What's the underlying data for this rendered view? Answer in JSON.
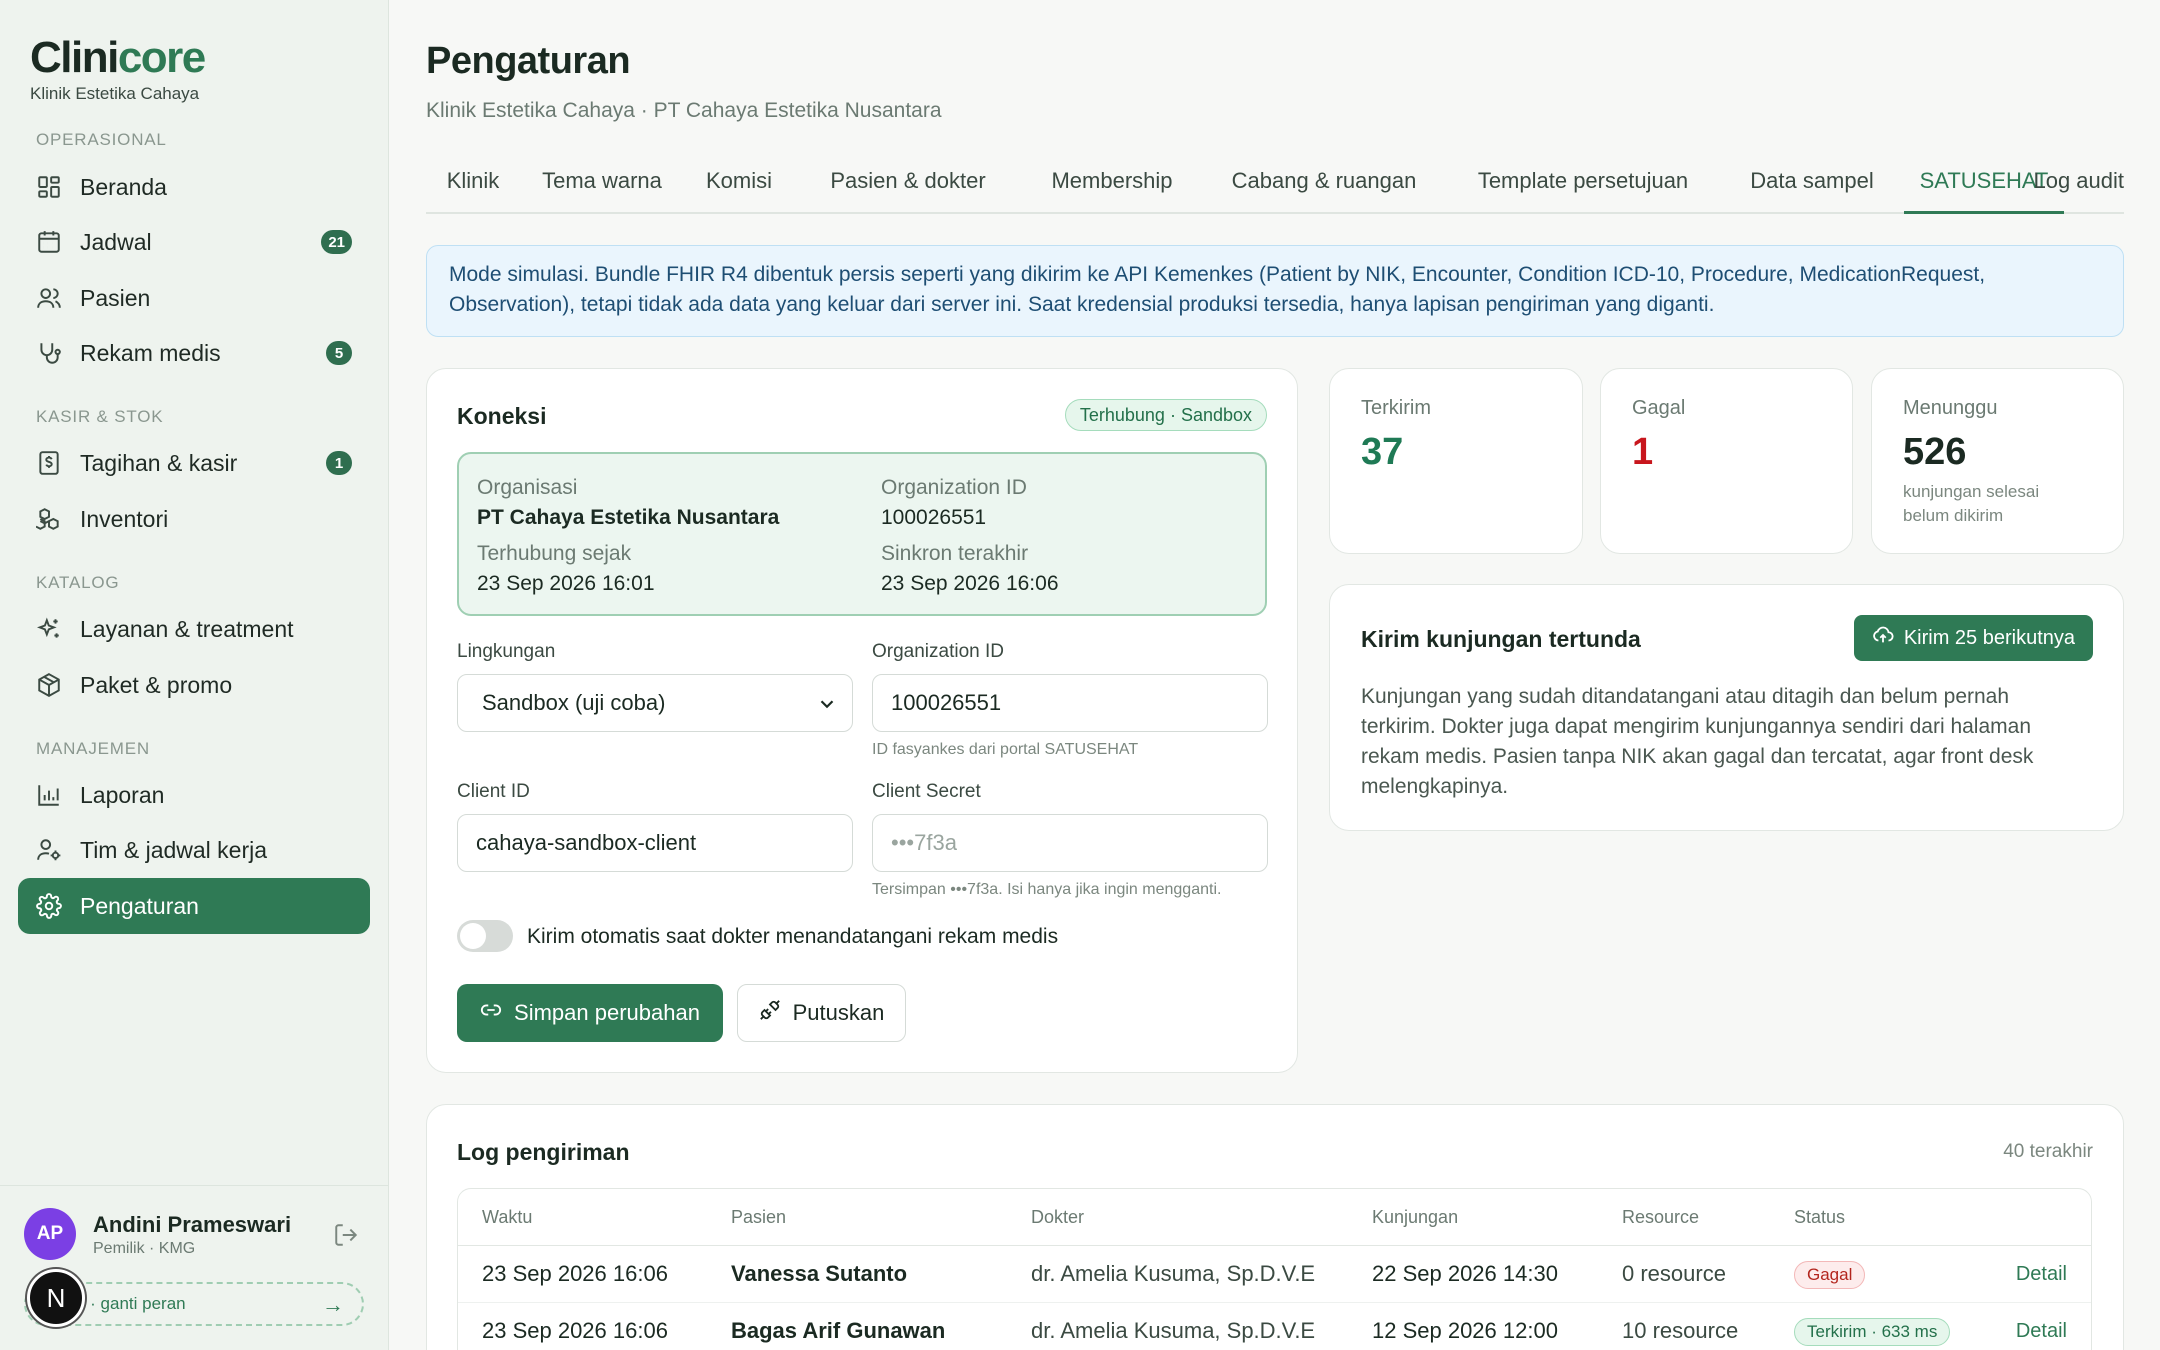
{
  "brand": {
    "name_part1": "Clini",
    "name_part2": "core",
    "clinic": "Klinik Estetika Cahaya"
  },
  "sidebar": {
    "sections": [
      "OPERASIONAL",
      "KASIR & STOK",
      "KATALOG",
      "MANAJEMEN"
    ],
    "items": [
      {
        "label": "Beranda",
        "icon": "grid-icon",
        "badge": ""
      },
      {
        "label": "Jadwal",
        "icon": "calendar-icon",
        "badge": "21"
      },
      {
        "label": "Pasien",
        "icon": "users-icon",
        "badge": ""
      },
      {
        "label": "Rekam medis",
        "icon": "stethoscope-icon",
        "badge": "5"
      },
      {
        "label": "Tagihan & kasir",
        "icon": "receipt-icon",
        "badge": "1"
      },
      {
        "label": "Inventori",
        "icon": "boxes-icon",
        "badge": ""
      },
      {
        "label": "Layanan & treatment",
        "icon": "sparkles-icon",
        "badge": ""
      },
      {
        "label": "Paket & promo",
        "icon": "package-icon",
        "badge": ""
      },
      {
        "label": "Laporan",
        "icon": "bar-chart-icon",
        "badge": ""
      },
      {
        "label": "Tim & jadwal kerja",
        "icon": "user-cog-icon",
        "badge": ""
      },
      {
        "label": "Pengaturan",
        "icon": "gear-icon",
        "badge": ""
      }
    ],
    "active_item": "Pengaturan"
  },
  "user": {
    "initials": "AP",
    "name": "Andini Prameswari",
    "role": "Pemilik · KMG",
    "switch_label": "o · ganti peran",
    "dev_bubble": "N"
  },
  "header": {
    "title": "Pengaturan",
    "subtitle": "Klinik Estetika Cahaya · PT Cahaya Estetika Nusantara"
  },
  "tabs": [
    "Klinik",
    "Tema warna",
    "Komisi",
    "Pasien & dokter",
    "Membership",
    "Cabang & ruangan",
    "Template persetujuan",
    "Data sampel",
    "SATUSEHAT",
    "Log audit"
  ],
  "active_tab": "SATUSEHAT",
  "notice": "Mode simulasi. Bundle FHIR R4 dibentuk persis seperti yang dikirim ke API Kemenkes (Patient by NIK, Encounter, Condition ICD-10, Procedure, MedicationRequest, Observation), tetapi tidak ada data yang keluar dari server ini. Saat kredensial produksi tersedia, hanya lapisan pengiriman yang diganti.",
  "connection": {
    "title": "Koneksi",
    "status": "Terhubung · Sandbox",
    "org_label": "Organisasi",
    "org_value": "PT Cahaya Estetika Nusantara",
    "org_id_label": "Organization ID",
    "org_id_value": "100026551",
    "since_label": "Terhubung sejak",
    "since_value": "23 Sep 2026 16:01",
    "sync_label": "Sinkron terakhir",
    "sync_value": "23 Sep 2026 16:06",
    "env_label": "Lingkungan",
    "env_value": "Sandbox (uji coba)",
    "orgid_field_label": "Organization ID",
    "orgid_field_value": "100026551",
    "orgid_hint": "ID fasyankes dari portal SATUSEHAT",
    "client_id_label": "Client ID",
    "client_id_value": "cahaya-sandbox-client",
    "client_secret_label": "Client Secret",
    "client_secret_placeholder": "•••7f3a",
    "client_secret_hint": "Tersimpan •••7f3a. Isi hanya jika ingin mengganti.",
    "auto_send_label": "Kirim otomatis saat dokter menandatangani rekam medis",
    "auto_send_on": false,
    "save_label": "Simpan perubahan",
    "disconnect_label": "Putuskan"
  },
  "stats": [
    {
      "label": "Terkirim",
      "value": "37",
      "color": "#1f7a55",
      "note": ""
    },
    {
      "label": "Gagal",
      "value": "1",
      "color": "#c8161d",
      "note": ""
    },
    {
      "label": "Menunggu",
      "value": "526",
      "color": "#1b2a22",
      "note": "kunjungan selesai belum dikirim"
    }
  ],
  "pending": {
    "title": "Kirim kunjungan tertunda",
    "button": "Kirim 25 berikutnya",
    "body": "Kunjungan yang sudah ditandatangani atau ditagih dan belum pernah terkirim. Dokter juga dapat mengirim kunjungannya sendiri dari halaman rekam medis. Pasien tanpa NIK akan gagal dan tercatat, agar front desk melengkapinya."
  },
  "log": {
    "title": "Log pengiriman",
    "count": "40 terakhir",
    "columns": [
      "Waktu",
      "Pasien",
      "Dokter",
      "Kunjungan",
      "Resource",
      "Status"
    ],
    "rows": [
      {
        "time": "23 Sep 2026 16:06",
        "patient": "Vanessa Sutanto",
        "doctor": "dr. Amelia Kusuma, Sp.D.V.E",
        "visit": "22 Sep 2026 14:30",
        "resource": "0 resource",
        "status": "Gagal",
        "status_type": "fail",
        "action": "Detail"
      },
      {
        "time": "23 Sep 2026 16:06",
        "patient": "Bagas Arif Gunawan",
        "doctor": "dr. Amelia Kusuma, Sp.D.V.E",
        "visit": "12 Sep 2026 12:00",
        "resource": "10 resource",
        "status": "Terkirim · 633 ms",
        "status_type": "ok",
        "action": "Detail"
      }
    ]
  }
}
